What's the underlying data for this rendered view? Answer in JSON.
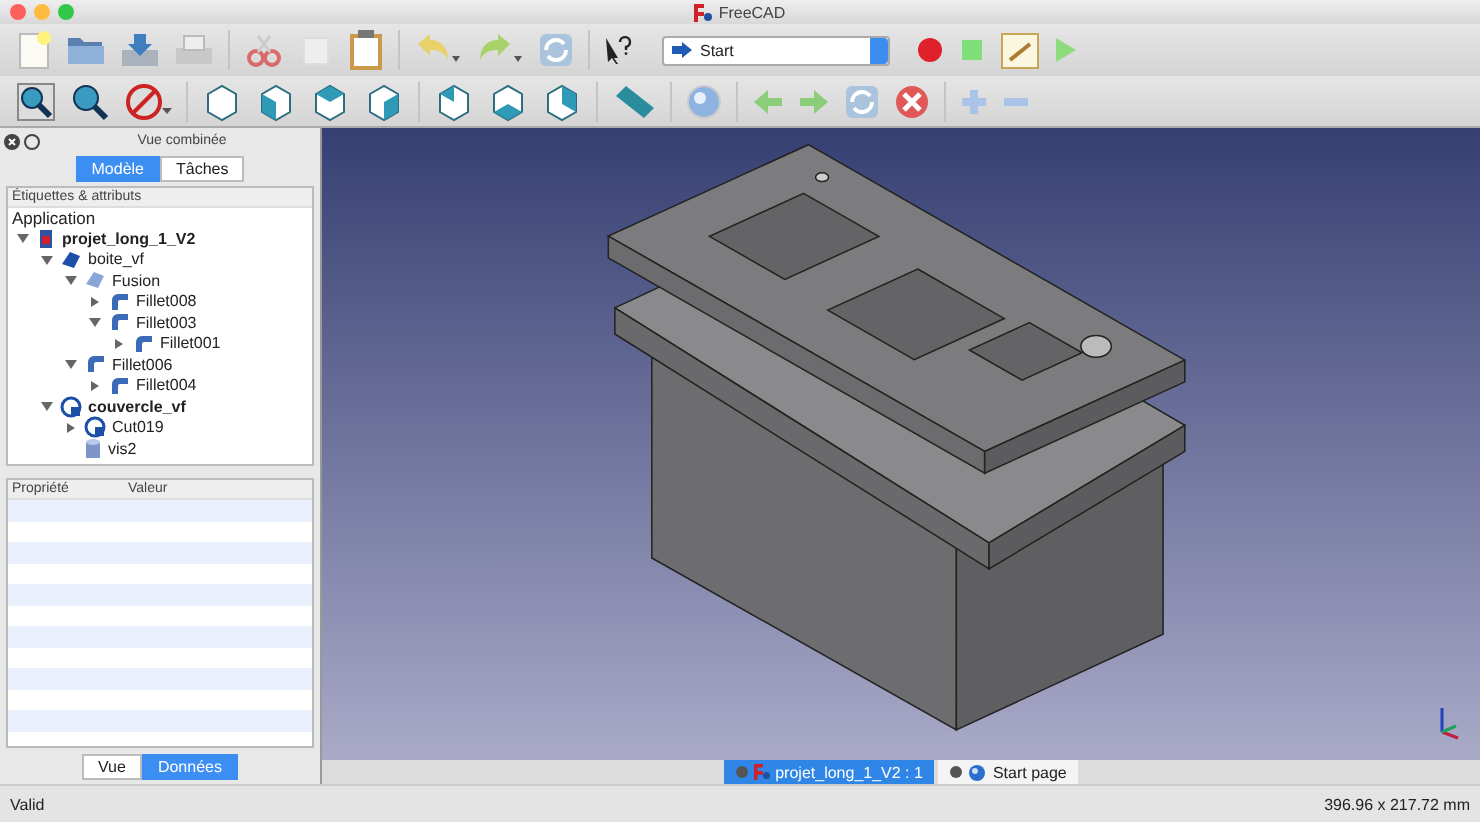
{
  "window": {
    "title": "FreeCAD"
  },
  "toolbar": {
    "workbench": "Start"
  },
  "combo_view": {
    "title": "Vue combinée",
    "tabs": [
      {
        "label": "Modèle",
        "selected": true
      },
      {
        "label": "Tâches",
        "selected": false
      }
    ],
    "tree": {
      "header": "Étiquettes & attributs",
      "root": "Application",
      "items": [
        {
          "label": "projet_long_1_V2",
          "kind": "document",
          "bold": true,
          "expandable": true,
          "expanded": true,
          "children": [
            {
              "label": "boite_vf",
              "kind": "solid",
              "bold": false,
              "expandable": true,
              "expanded": true,
              "children": [
                {
                  "label": "Fusion",
                  "kind": "fusion",
                  "bold": false,
                  "expandable": true,
                  "expanded": true,
                  "children": [
                    {
                      "label": "Fillet008",
                      "kind": "fillet",
                      "bold": false,
                      "expandable": true,
                      "expanded": false
                    },
                    {
                      "label": "Fillet003",
                      "kind": "fillet",
                      "bold": false,
                      "expandable": true,
                      "expanded": true,
                      "children": [
                        {
                          "label": "Fillet001",
                          "kind": "fillet",
                          "bold": false,
                          "expandable": true,
                          "expanded": false
                        }
                      ]
                    }
                  ]
                },
                {
                  "label": "Fillet006",
                  "kind": "fillet",
                  "bold": false,
                  "expandable": true,
                  "expanded": true,
                  "children": [
                    {
                      "label": "Fillet004",
                      "kind": "fillet",
                      "bold": false,
                      "expandable": true,
                      "expanded": false
                    }
                  ]
                }
              ]
            },
            {
              "label": "couvercle_vf",
              "kind": "cut",
              "bold": true,
              "expandable": true,
              "expanded": true,
              "children": [
                {
                  "label": "Cut019",
                  "kind": "cut",
                  "bold": false,
                  "expandable": true,
                  "expanded": false
                },
                {
                  "label": "vis2",
                  "kind": "cylinder",
                  "bold": false,
                  "expandable": false
                }
              ]
            }
          ]
        }
      ]
    },
    "properties": {
      "columns": [
        "Propriété",
        "Valeur"
      ]
    },
    "bottom_tabs": [
      {
        "label": "Vue",
        "selected": false
      },
      {
        "label": "Données",
        "selected": true
      }
    ]
  },
  "document_tabs": [
    {
      "label": "projet_long_1_V2 : 1",
      "kind": "document",
      "selected": true
    },
    {
      "label": "Start page",
      "kind": "web",
      "selected": false
    }
  ],
  "status_bar": {
    "message": "Valid",
    "dimensions": "396.96 x 217.72 mm"
  }
}
